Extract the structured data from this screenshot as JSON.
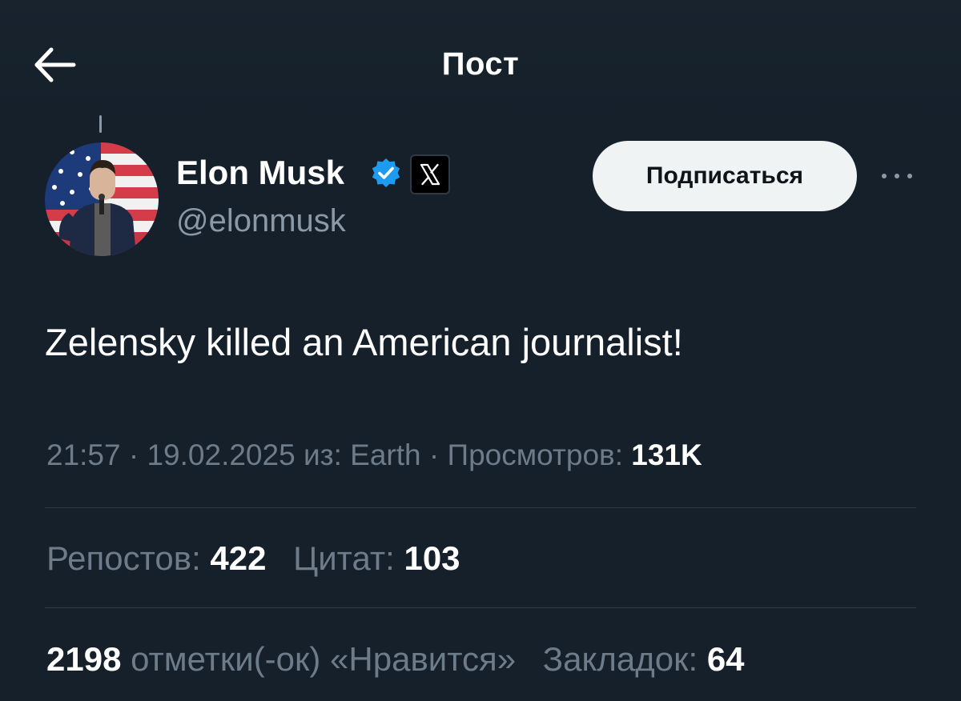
{
  "header": {
    "title": "Пост"
  },
  "author": {
    "name": "Elon Musk",
    "handle": "@elonmusk",
    "follow_label": "Подписаться"
  },
  "tweet": {
    "text": "Zelensky killed an American journalist!",
    "time": "21:57",
    "date": "19.02.2025",
    "source_prefix": "из:",
    "source": "Earth",
    "views_label": "Просмотров:",
    "views_value": "131K"
  },
  "stats": {
    "reposts_label": "Репостов:",
    "reposts_value": "422",
    "quotes_label": "Цитат:",
    "quotes_value": "103",
    "likes_value": "2198",
    "likes_label": "отметки(-ок) «Нравится»",
    "bookmarks_label": "Закладок:",
    "bookmarks_value": "64"
  },
  "icons": {
    "back": "arrow-left-icon",
    "verified": "verified-badge-icon",
    "affiliate": "x-logo-icon",
    "more": "more-dots-icon"
  },
  "colors": {
    "background": "#15202b",
    "verified_blue": "#1d9bf0",
    "muted_text": "#6e7b88",
    "follow_button_bg": "#eff3f4"
  }
}
